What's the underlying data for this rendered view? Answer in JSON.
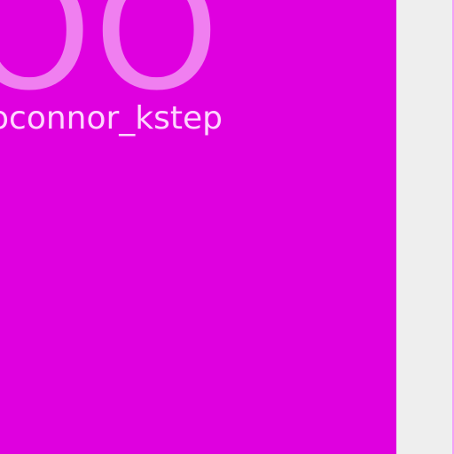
{
  "colors": {
    "panel_bg": "#df00df",
    "initials_color": "#f07ff0",
    "username_color": "#ffd6ff",
    "side_bg": "#eeeeee",
    "edge_line": "#f4a0f4"
  },
  "profile": {
    "initials": "OO",
    "username": "oconnor_kstep"
  }
}
